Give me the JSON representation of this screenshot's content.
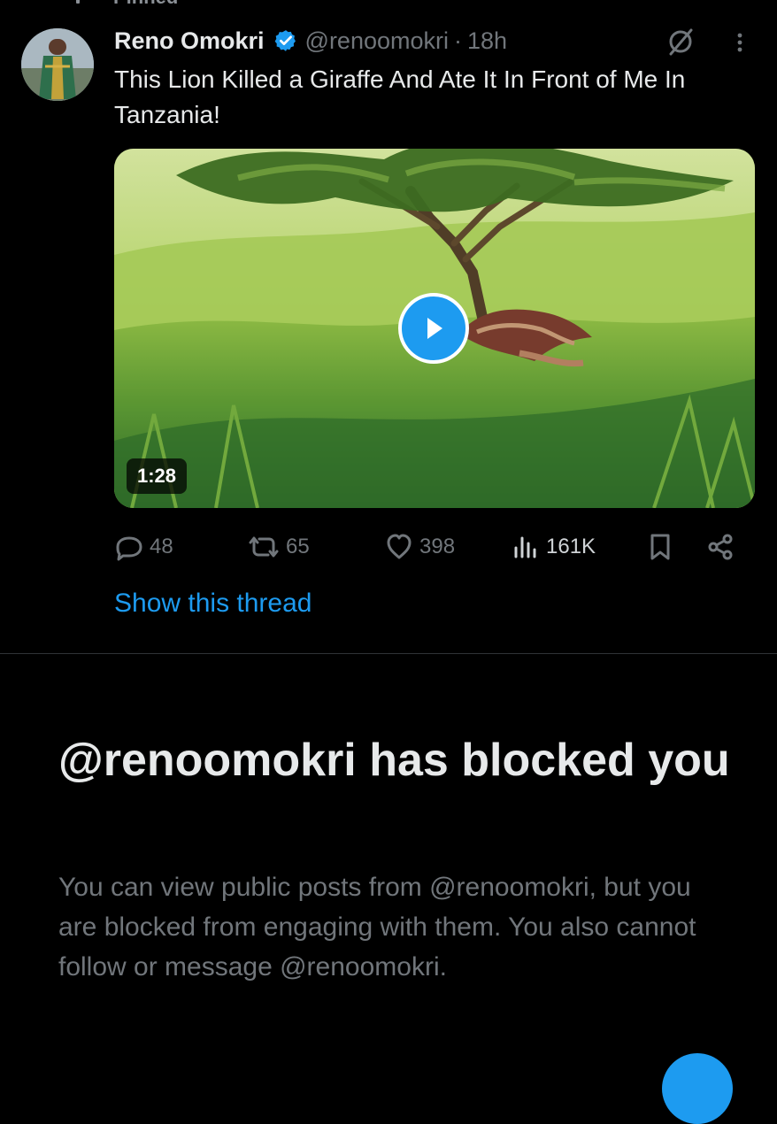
{
  "pinned": {
    "label": "Pinned",
    "icon": "pin-icon"
  },
  "tweet": {
    "author_name": "Reno Omokri",
    "verified": true,
    "handle": "@renoomokri",
    "separator": "·",
    "time": "18h",
    "text": "This Lion Killed a Giraffe And Ate It In Front of Me In Tanzania!",
    "media": {
      "type": "video",
      "duration": "1:28",
      "icon": "play-icon"
    },
    "stats": {
      "replies": "48",
      "reposts": "65",
      "likes": "398",
      "views": "161K"
    },
    "show_thread": "Show this thread"
  },
  "blocked_notice": {
    "title": "@renoomokri has blocked you",
    "message": "You can view public posts from @renoomokri, but you are blocked from engaging with them. You also cannot follow or message @renoomokri."
  },
  "colors": {
    "background": "#000000",
    "accent": "#1d9bf0",
    "primary_text": "#e7e9ea",
    "secondary_text": "#71767b",
    "divider": "#2f3336"
  }
}
